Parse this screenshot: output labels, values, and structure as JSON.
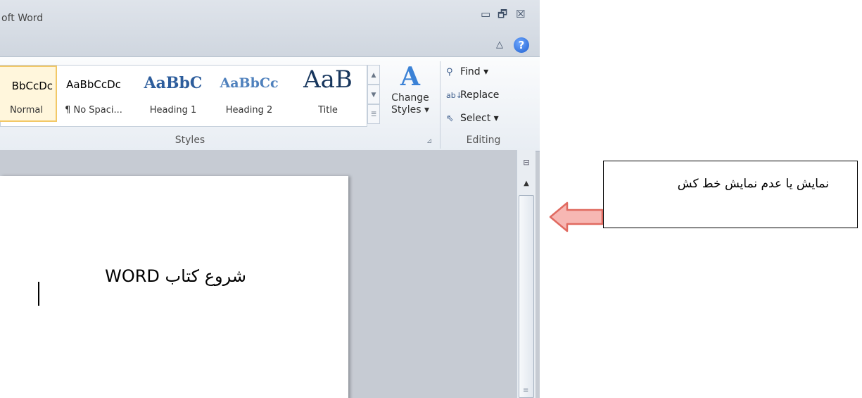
{
  "app": {
    "title": "oft Word",
    "window_controls": {
      "minimize_icon": "minimize-icon",
      "restore_icon": "restore-icon",
      "close_icon": "close-icon"
    },
    "help_label": "?"
  },
  "ribbon": {
    "styles_group": {
      "label": "Styles",
      "items": [
        {
          "sample": "BbCcDc",
          "name": "Normal",
          "selected": true
        },
        {
          "sample": "AaBbCcDc",
          "name": "¶ No Spaci..."
        },
        {
          "sample": "AaBbC",
          "name": "Heading 1"
        },
        {
          "sample": "AaBbCc",
          "name": "Heading 2"
        },
        {
          "sample": "AaB",
          "name": "Title"
        }
      ]
    },
    "change_styles": {
      "line1": "Change",
      "line2": "Styles ▾"
    },
    "editing_group": {
      "label": "Editing",
      "find": "Find ▾",
      "replace": "Replace",
      "select": "Select ▾"
    }
  },
  "document": {
    "text": "شروع کتاب WORD"
  },
  "callout": {
    "text": "نمایش یا عدم نمایش خط کش"
  },
  "colors": {
    "accent": "#1f5fcf",
    "arrow_fill": "#f7b7b3",
    "arrow_stroke": "#e06a60",
    "selected_style_border": "#f2c867"
  }
}
